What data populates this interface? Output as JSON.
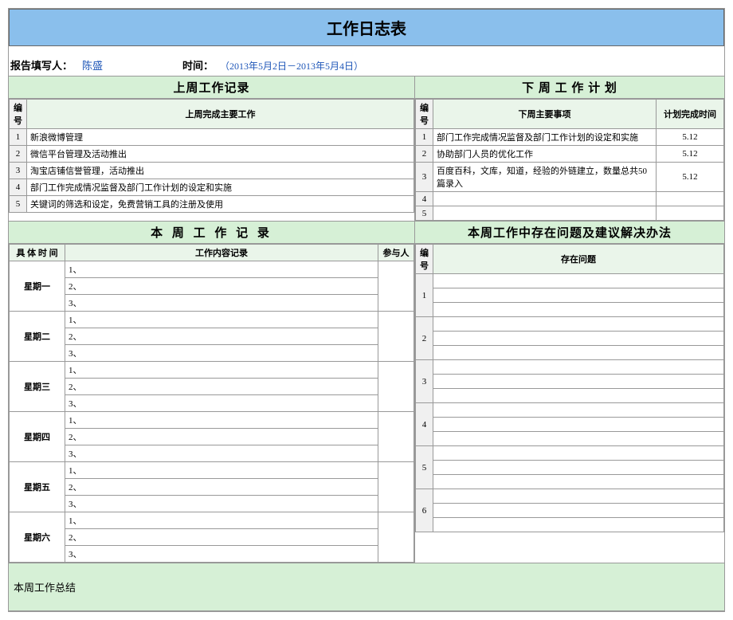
{
  "title": "工作日志表",
  "header": {
    "reporter_label": "报告填写人：",
    "reporter_value": "陈盛",
    "time_label": "时间：",
    "time_value": "（2013年5月2日－2013年5月4日）"
  },
  "last_week": {
    "section_title": "上周工作记录",
    "col_no": "编号",
    "col_main": "上周完成主要工作",
    "rows": [
      {
        "no": "1",
        "text": "新浪微博管理"
      },
      {
        "no": "2",
        "text": "微信平台管理及活动推出"
      },
      {
        "no": "3",
        "text": "淘宝店铺信誉管理，活动推出"
      },
      {
        "no": "4",
        "text": "部门工作完成情况监督及部门工作计划的设定和实施"
      },
      {
        "no": "5",
        "text": "关键词的筛选和设定，免费营销工具的注册及使用"
      }
    ]
  },
  "next_week": {
    "section_title": "下 周 工 作 计 划",
    "col_no": "编号",
    "col_main": "下周主要事项",
    "col_time": "计划完成时间",
    "rows": [
      {
        "no": "1",
        "text": "部门工作完成情况监督及部门工作计划的设定和实施",
        "time": "5.12"
      },
      {
        "no": "2",
        "text": "协助部门人员的优化工作",
        "time": "5.12"
      },
      {
        "no": "3",
        "text": "百度百科，文库，知道，经验的外链建立，数量总共50篇录入",
        "time": "5.12"
      },
      {
        "no": "4",
        "text": "",
        "time": ""
      },
      {
        "no": "5",
        "text": "",
        "time": ""
      }
    ]
  },
  "this_week": {
    "section_title": "本 周 工 作 记 录",
    "col_time": "具 体 时 间",
    "col_content": "工作内容记录",
    "col_participant": "参与人",
    "days": [
      {
        "label": "星期一",
        "lines": [
          "1、",
          "2、",
          "3、"
        ]
      },
      {
        "label": "星期二",
        "lines": [
          "1、",
          "2、",
          "3、"
        ]
      },
      {
        "label": "星期三",
        "lines": [
          "1、",
          "2、",
          "3、"
        ]
      },
      {
        "label": "星期四",
        "lines": [
          "1、",
          "2、",
          "3、"
        ]
      },
      {
        "label": "星期五",
        "lines": [
          "1、",
          "2、",
          "3、"
        ]
      },
      {
        "label": "星期六",
        "lines": [
          "1、",
          "2、",
          "3、"
        ]
      }
    ]
  },
  "issues": {
    "section_title": "本周工作中存在问题及建议解决办法",
    "col_no": "编号",
    "col_problem": "存在问题",
    "rows": [
      {
        "no": "1"
      },
      {
        "no": "2"
      },
      {
        "no": "3"
      },
      {
        "no": "4"
      },
      {
        "no": "5"
      },
      {
        "no": "6"
      }
    ]
  },
  "summary_label": "本周工作总结"
}
